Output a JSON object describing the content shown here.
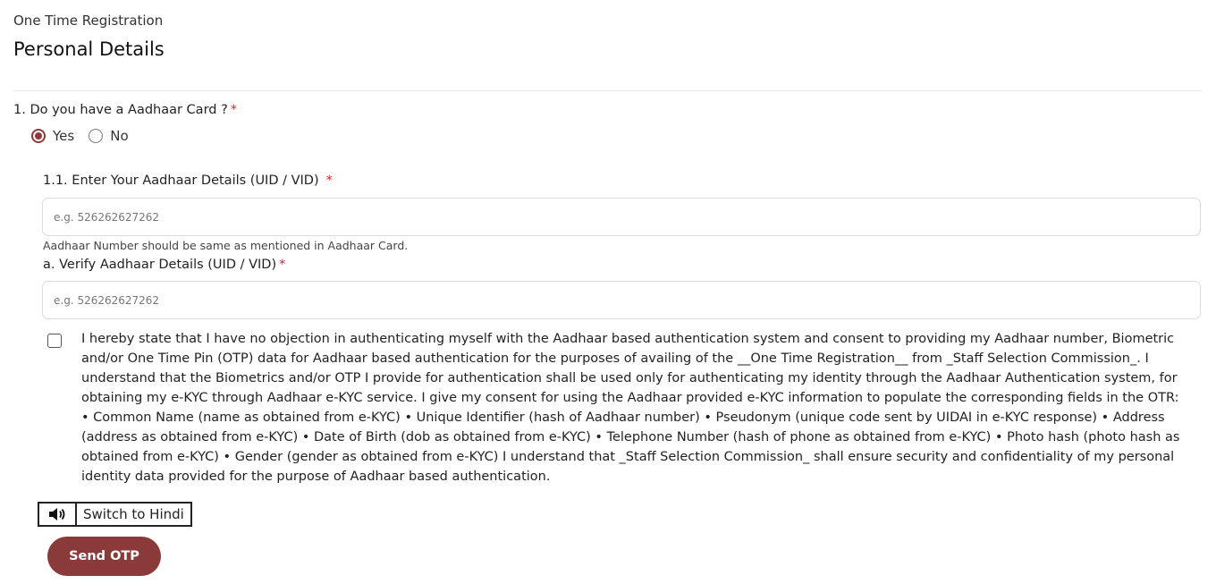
{
  "header": {
    "breadcrumb": "One Time Registration",
    "title": "Personal Details"
  },
  "aadhaar_question": {
    "label": "1. Do you have a Aadhaar Card ?",
    "required_mark": "*",
    "options": [
      {
        "label": "Yes",
        "selected": true
      },
      {
        "label": "No",
        "selected": false
      }
    ]
  },
  "uid_field": {
    "label": "1.1. Enter Your Aadhaar Details (UID / VID)",
    "required_mark": "*",
    "placeholder": "e.g. 526262627262",
    "value": "",
    "helper": "Aadhaar Number should be same as mentioned in Aadhaar Card."
  },
  "verify_field": {
    "label": "a. Verify Aadhaar Details (UID / VID)",
    "required_mark": "*",
    "placeholder": "e.g. 526262627262",
    "value": ""
  },
  "consent": {
    "checked": false,
    "text": "I hereby state that I have no objection in authenticating myself with the Aadhaar based authentication system and consent to providing my Aadhaar number, Biometric and/or One Time Pin (OTP) data for Aadhaar based authentication for the purposes of availing of the __One Time Registration__ from _Staff Selection Commission_. I understand that the Biometrics and/or OTP I provide for authentication shall be used only for authenticating my identity through the Aadhaar Authentication system, for obtaining my e-KYC through Aadhaar e-KYC service. I give my consent for using the Aadhaar provided e-KYC information to populate the corresponding fields in the OTR: • Common Name (name as obtained from e-KYC) • Unique Identifier (hash of Aadhaar number) • Pseudonym (unique code sent by UIDAI in e-KYC response) • Address (address as obtained from e-KYC) • Date of Birth (dob as obtained from e-KYC) • Telephone Number (hash of phone as obtained from e-KYC) • Photo hash (photo hash as obtained from e-KYC) • Gender (gender as obtained from e-KYC) I understand that _Staff Selection Commission_ shall ensure security and confidentiality of my personal identity data provided for the purpose of Aadhaar based authentication."
  },
  "language_bar": {
    "speaker_icon": "speaker-icon",
    "switch_label": "Switch to Hindi"
  },
  "actions": {
    "send_otp_label": "Send OTP",
    "primary_color": "#8b3a3a"
  }
}
